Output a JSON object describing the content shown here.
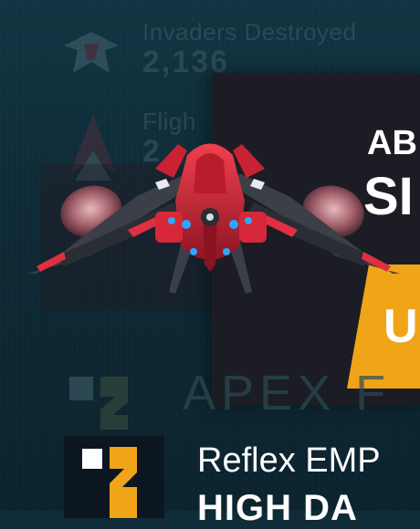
{
  "stats": {
    "invaders_label": "Invaders Destroyed",
    "invaders_value": "2,136",
    "flight_label": "Fligh",
    "flight_value": "2"
  },
  "panel": {
    "title": "AB",
    "subtitle": "SI",
    "button_label": "U"
  },
  "apex_label": "APEX F",
  "item": {
    "name": "Reflex EMP",
    "subtitle": "HIGH DA"
  },
  "colors": {
    "background": "#0f2c38",
    "panel": "#1c1d24",
    "accent": "#f0a418",
    "ship_red": "#d9283a",
    "ship_glow": "#2aa8ff"
  },
  "icons": [
    "invader-emblem-icon",
    "flight-emblem-icon",
    "item-emblem-icon"
  ]
}
